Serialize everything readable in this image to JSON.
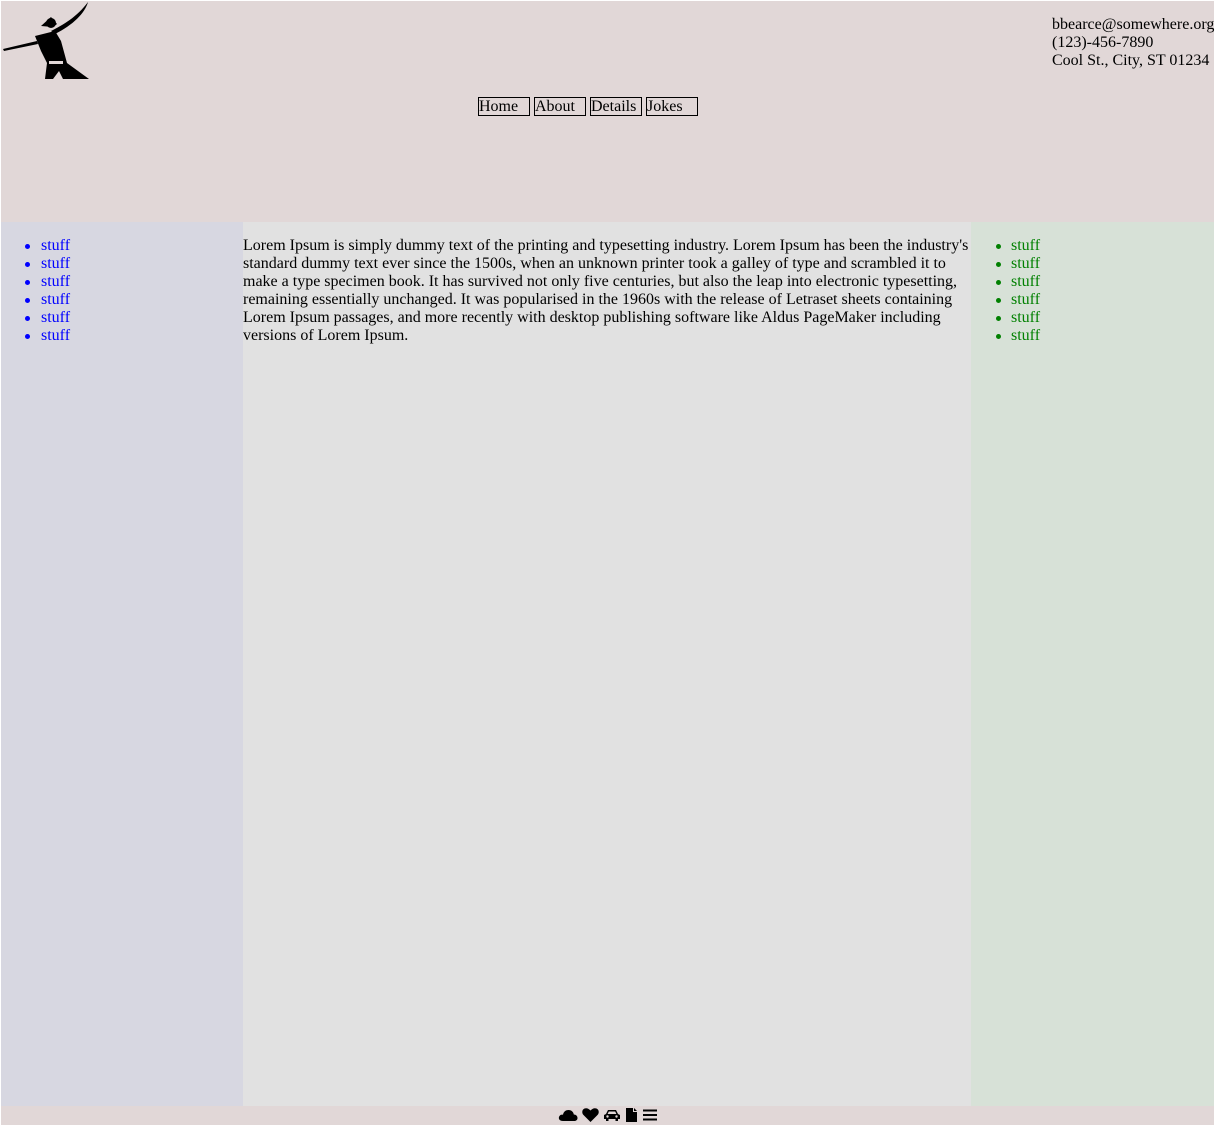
{
  "header": {
    "logo_icon": "samurai-logo-icon",
    "contact": {
      "email": "bbearce@somewhere.org",
      "phone": "(123)-456-7890",
      "address": "Cool St., City, ST 01234"
    },
    "nav": [
      "Home",
      "About",
      "Details",
      "Jokes"
    ]
  },
  "left_sidebar": {
    "items": [
      "stuff",
      "stuff",
      "stuff",
      "stuff",
      "stuff",
      "stuff"
    ],
    "color": "#0000ff"
  },
  "main": {
    "text": "Lorem Ipsum is simply dummy text of the printing and typesetting industry. Lorem Ipsum has been the industry's standard dummy text ever since the 1500s, when an unknown printer took a galley of type and scrambled it to make a type specimen book. It has survived not only five centuries, but also the leap into electronic typesetting, remaining essentially unchanged. It was popularised in the 1960s with the release of Letraset sheets containing Lorem Ipsum passages, and more recently with desktop publishing software like Aldus PageMaker including versions of Lorem Ipsum."
  },
  "right_sidebar": {
    "items": [
      "stuff",
      "stuff",
      "stuff",
      "stuff",
      "stuff",
      "stuff"
    ],
    "color": "#008000"
  },
  "footer": {
    "icons": [
      "cloud-icon",
      "heart-icon",
      "car-icon",
      "file-icon",
      "menu-icon"
    ]
  },
  "colors": {
    "header_bg": "#e1d7d7",
    "left_bg": "#d7d7e1",
    "center_bg": "#e1e1e1",
    "right_bg": "#d7e1d7"
  }
}
